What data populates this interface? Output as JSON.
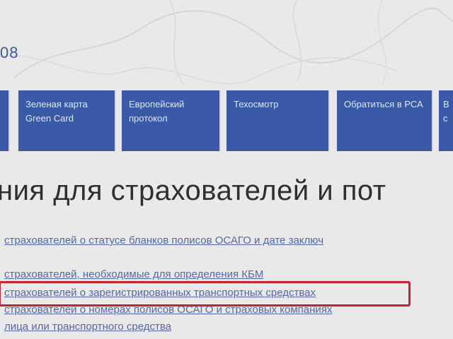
{
  "header": {
    "date_fragment": "08"
  },
  "nav": {
    "items": [
      {
        "label": "Зеленая карта Green Card"
      },
      {
        "label": "Европейский протокол"
      },
      {
        "label": "Техосмотр"
      },
      {
        "label": "Обратиться в РСА"
      },
      {
        "label": "В с"
      }
    ]
  },
  "page": {
    "title": "ния для страхователей и пот"
  },
  "links": [
    {
      "text": "страхователей о статусе бланков полисов ОСАГО и дате заключ"
    },
    {
      "text": "страхователей, необходимые для определения КБМ"
    },
    {
      "text": "страхователей о зарегистрированных транспортных средствах"
    },
    {
      "text": "страхователей о номерах полисов ОСАГО и страховых компаниях"
    },
    {
      "text": "лица или транспортного средства"
    }
  ],
  "colors": {
    "nav_background": "#3a5aa8",
    "link": "#3d4fa0",
    "highlight_border": "#c1272d"
  }
}
